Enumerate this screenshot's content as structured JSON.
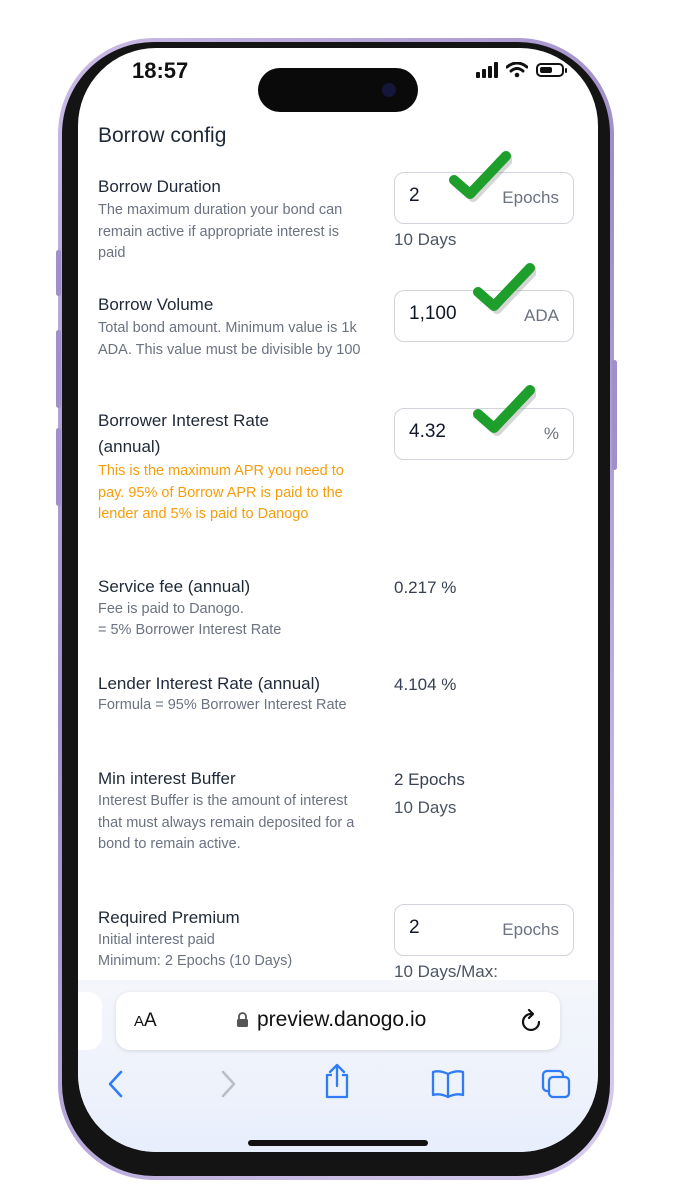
{
  "status": {
    "time": "18:57"
  },
  "section_title": "Borrow config",
  "borrow_duration": {
    "title": "Borrow Duration",
    "desc": "The maximum duration your bond can remain active if appropriate interest is paid",
    "value": "2",
    "unit": "Epochs",
    "sub": "10 Days"
  },
  "borrow_volume": {
    "title": "Borrow Volume",
    "desc": "Total bond amount. Minimum value is 1k ADA. This value must be divisible by 100",
    "value": "1,100",
    "unit": "ADA"
  },
  "borrower_rate": {
    "title": "Borrower Interest Rate (annual)",
    "desc": "This is the maximum APR you need to pay. 95% of Borrow APR is paid to the lender and 5% is paid to Danogo",
    "value": "4.32",
    "unit": "%"
  },
  "service_fee": {
    "title": "Service fee (annual)",
    "desc_line1": "Fee is paid to Danogo.",
    "desc_line2": "= 5% Borrower Interest Rate",
    "value": "0.217 %"
  },
  "lender_rate": {
    "title": "Lender Interest Rate (annual)",
    "desc": "Formula = 95% Borrower Interest Rate",
    "value": "4.104 %"
  },
  "min_buffer": {
    "title": "Min interest Buffer",
    "desc": "Interest Buffer is the amount of interest that must always remain deposited for a bond to remain active.",
    "value": "2 Epochs",
    "sub": "10 Days"
  },
  "required_premium": {
    "title": "Required Premium",
    "desc_line1": "Initial interest paid",
    "desc_line2": "Minimum: 2 Epochs (10 Days)",
    "value": "2",
    "unit": "Epochs",
    "sub": "10 Days/Max:"
  },
  "browser": {
    "aa_big": "A",
    "aa_small": "A",
    "url": "preview.danogo.io"
  },
  "icons": [
    "lock-icon",
    "reload-icon",
    "back-icon",
    "forward-icon",
    "share-icon",
    "bookmarks-icon",
    "tabs-icon",
    "checkmark-icon"
  ],
  "colors": {
    "accent_warn": "#f59e0b",
    "check_green": "#1e9e2a",
    "safari_blue": "#2f7cf6"
  }
}
